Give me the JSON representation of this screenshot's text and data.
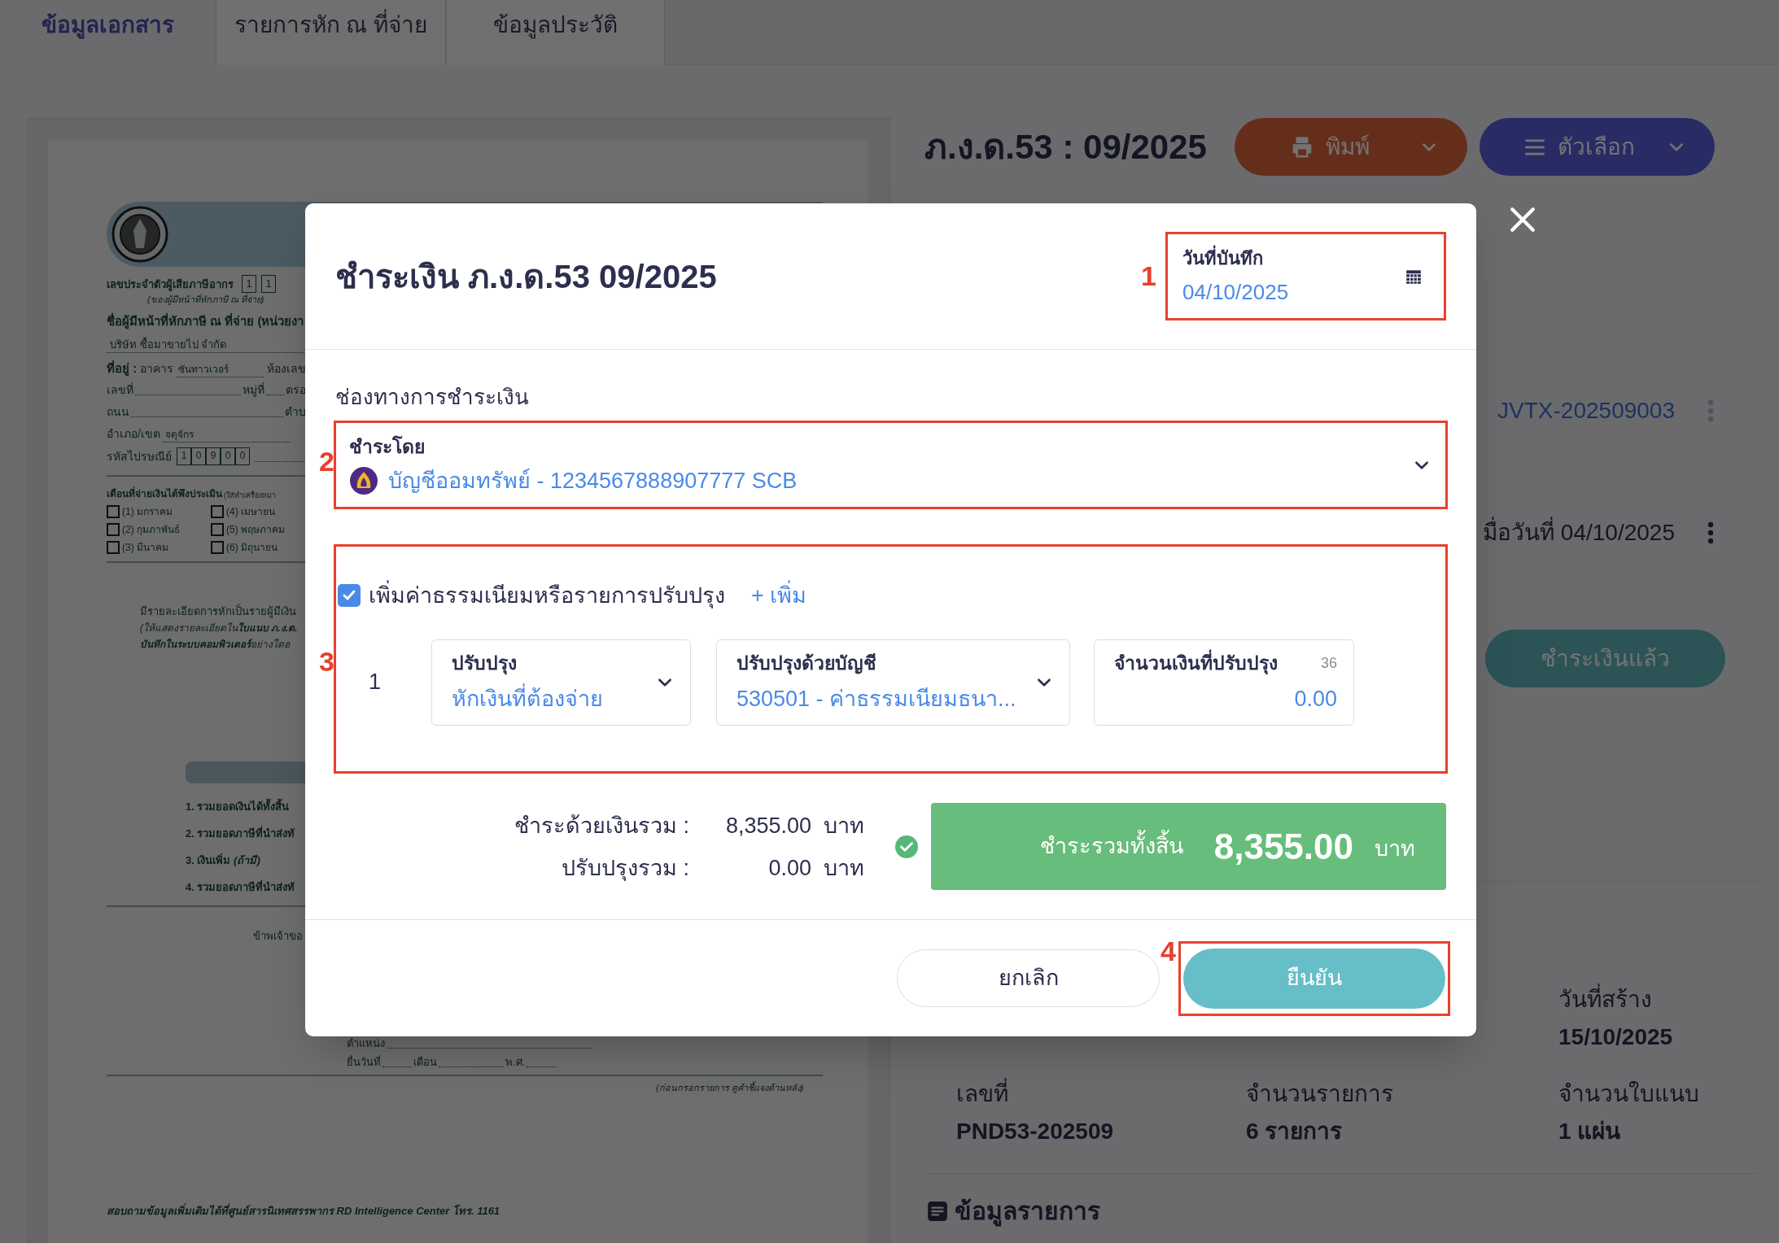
{
  "tabs": [
    {
      "label": "ข้อมูลเอกสาร",
      "selected": true
    },
    {
      "label": "รายการหัก ณ ที่จ่าย",
      "selected": false
    },
    {
      "label": "ข้อมูลประวัติ",
      "selected": false
    }
  ],
  "document_preview": {
    "tax_id_label": "เลขประจำตัวผู้เสียภาษีอากร",
    "tax_id_note": "(ของผู้มีหน้าที่หักภาษี ณ ที่จ่าย)",
    "tax_id_digits": [
      "1",
      "1"
    ],
    "payer_label": "ชื่อผู้มีหน้าที่หักภาษี ณ ที่จ่าย (หน่วยงา",
    "payer_name": "บริษัท ซื้อมาขายไป จำกัด",
    "address_label": "ที่อยู่ :",
    "building_label": "อาคาร",
    "building_value": "ซันทาวเวอร์",
    "room_label": "ห้องเลข",
    "number_label": "เลขที่",
    "moo_label": "หมู่ที่",
    "alley_label": "ตรอ",
    "road_label": "ถนน",
    "subdistrict_label": "ตำบ",
    "district_label": "อำเภอ/เขต",
    "district_value": "จตุจักร",
    "postcode_label": "รหัสไปรษณีย์",
    "postcode_digits": [
      "1",
      "0",
      "9",
      "0",
      "0"
    ],
    "months_label": "เดือนที่จ่ายเงินได้พึงประเมิน",
    "months_note": "(ให้ทำเครื่องหมา",
    "months": [
      {
        "label": "(1) มกราคม",
        "checked": false
      },
      {
        "label": "(4) เมษายน",
        "checked": false
      },
      {
        "label": "(2) กุมภาพันธ์",
        "checked": false
      },
      {
        "label": "(5) พฤษภาคม",
        "checked": false
      },
      {
        "label": "(3) มีนาคม",
        "checked": false
      },
      {
        "label": "(6) มิถุนายน",
        "checked": false
      }
    ],
    "detail_lines": [
      {
        "kind": "text",
        "text": "มีรายละเอียดการหักเป็นรายผู้มีเงิน"
      },
      {
        "kind": "note",
        "text": "(ให้แสดงรายละเอียดใน**ใบแนบ ภ.ง.ด.**"
      },
      {
        "kind": "note",
        "text": "**บันทึกในระบบคอมพิวเตอร์**อย่างใดอ"
      }
    ],
    "summary_lines": [
      "**1.** รวมยอดเงินได้ทั้งสิ้น",
      "**2.** รวมยอดภาษีที่นำส่งทั",
      "**3.** เงินเพิ่ม *(ถ้ามี)*",
      "**4.** รวมยอดภาษีที่นำส่งทั"
    ],
    "declaration": "ข้าพเจ้าขอ",
    "position_label": "ตำแหน่ง",
    "filed_labels": [
      "ยื่นวันที่",
      "เดือน",
      "พ.ศ."
    ],
    "instruction_note": "(ก่อนกรอกรายการ ดูคำชี้แจงด้านหลัง)",
    "footer": "สอบถามข้อมูลเพิ่มเติมได้ที่ศูนย์สารนิเทศสรรพากร RD Intelligence Center โทร. 1161"
  },
  "header": {
    "title": "ภ.ง.ด.53 : 09/2025",
    "print_button": "พิมพ์",
    "options_button": "ตัวเลือก"
  },
  "side_entries": [
    {
      "kind": "link",
      "text": "JVTX-202509003"
    },
    {
      "kind": "text",
      "text": "มื่อวันที่ 04/10/2025"
    }
  ],
  "status_button": "ชำระเงินแล้ว",
  "details": [
    {
      "label": "วันที่สร้าง",
      "value": "15/10/2025"
    },
    {
      "label": "เลขที่",
      "value": "PND53-202509"
    },
    {
      "label": "จำนวนรายการ",
      "value": "6 รายการ"
    },
    {
      "label": "จำนวนใบแนบ",
      "value": "1 แผ่น"
    }
  ],
  "section_title": "ข้อมูลรายการ",
  "payment_dialog": {
    "title": "ชำระเงิน ภ.ง.ด.53 09/2025",
    "date_field": {
      "label": "วันที่บันทึก",
      "value": "04/10/2025"
    },
    "channel_heading": "ช่องทางการชำระเงิน",
    "pay_by": {
      "label": "ชำระโดย",
      "value": "บัญชีออมทรัพย์ - 1234567888907777 SCB"
    },
    "adjustments": {
      "enabled": true,
      "label": "เพิ่มค่าธรรมเนียมหรือรายการปรับปรุง",
      "add_link": "+ เพิ่ม",
      "rows": [
        {
          "index": "1",
          "type": {
            "label": "ปรับปรุง",
            "value": "หักเงินที่ต้องจ่าย"
          },
          "account": {
            "label": "ปรับปรุงด้วยบัญชี",
            "value": "530501 - ค่าธรรมเนียมธนา..."
          },
          "amount": {
            "label": "จำนวนเงินที่ปรับปรุง",
            "counter": "36",
            "value": "0.00"
          }
        }
      ]
    },
    "summary": [
      {
        "label": "ชำระด้วยเงินรวม :",
        "amount": "8,355.00",
        "unit": "บาท"
      },
      {
        "label": "ปรับปรุงรวม :",
        "amount": "0.00",
        "unit": "บาท"
      }
    ],
    "total": {
      "label": "ชำระรวมทั้งสิ้น",
      "amount": "8,355.00",
      "unit": "บาท"
    },
    "cancel_button": "ยกเลิก",
    "confirm_button": "ยืนยัน"
  },
  "annotations": [
    "1",
    "2",
    "3",
    "4"
  ]
}
